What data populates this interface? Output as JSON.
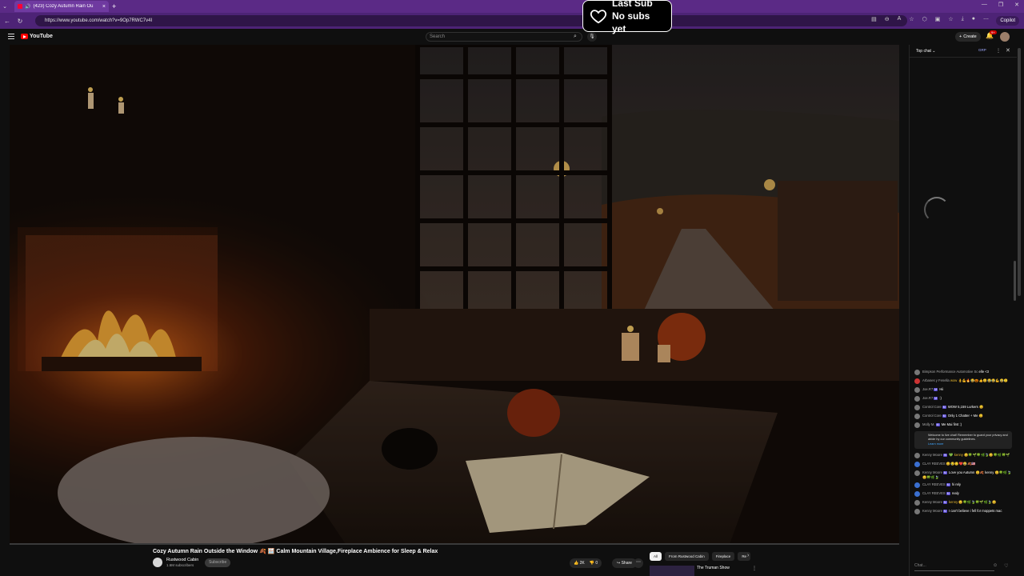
{
  "browser": {
    "tab_title": "(423) Cozy Autumn Rain Ou",
    "tab_close": "×",
    "new_tab": "+",
    "url": "https://www.youtube.com/watch?v=9Op7RWC7v4I",
    "copilot_label": "Copilot"
  },
  "overlay": {
    "line1": "Last Sub",
    "line2": "No subs yet"
  },
  "youtube": {
    "logo_text": "YouTube",
    "search_placeholder": "Search",
    "create_label": "Create",
    "notifications_count": "9+"
  },
  "video": {
    "progress_fraction": 0.0,
    "title": "Cozy Autumn Rain Outside the Window 🍂 🪟 Calm Mountain Village,Fireplace Ambience for Sleep & Relax",
    "channel_name": "Rustwood Cabin",
    "channel_subs": "1.6M subscribers",
    "subscribe_label": "Subscribe",
    "like_count": "2K",
    "dislike_count": "0",
    "share_label": "Share",
    "chips": [
      "All",
      "From Rustwood Cabin",
      "Fireplace",
      "Re"
    ],
    "rec_title": "The Truman Show"
  },
  "chat": {
    "mode": "Top chat",
    "group_label": "GRP",
    "input_placeholder": "Chat...",
    "messages": [
      {
        "name": "Bimpson Performance Automotive Sc",
        "badge": "",
        "text": "elle <3"
      },
      {
        "name": "Arbanes y Fenella",
        "badge": "",
        "text": "wow 👌💪🔥😂🎃👍😊😂😂💪😂🙂"
      },
      {
        "name": "Joe.R7",
        "badge": "M",
        "text": "Hii"
      },
      {
        "name": "Joe.R7",
        "badge": "M",
        "text": ":)"
      },
      {
        "name": "Control Core",
        "badge": "M",
        "text": "WOW 5,159 Lurkers 😊"
      },
      {
        "name": "Control Core",
        "badge": "M",
        "text": "Only 1 Chatter + Me 😊"
      },
      {
        "name": "Molly M.",
        "badge": "M",
        "text": "Me Mai first :)"
      }
    ],
    "notice_text": "Welcome to live chat! Remember to guard your privacy and abide by our community guidelines.",
    "notice_link": "Learn more",
    "messages2": [
      {
        "name": "Kenny Moore",
        "badge": "Hi",
        "text": "💚 kenny 😊🍀🌱🍀🌿🍃😊🍀🌿🍀🌱"
      },
      {
        "name": "CLAY REEVES",
        "badge": "",
        "text": "😊😢🙂❤️😂🍂🇺🇸"
      },
      {
        "name": "Kenny Moore",
        "badge": "M",
        "text": "Love you Autumn 😊🍂 kenny 😊🍀🌿🍃😊🍀🌿🍃"
      },
      {
        "name": "CLAY REEVES",
        "badge": "M",
        "text": "hi rely"
      },
      {
        "name": "CLAY REEVES",
        "badge": "M",
        "text": "realy"
      },
      {
        "name": "Kenny Moore",
        "badge": "M",
        "text": "kenny 😊🍀🌿🍃🍀🌱🌿🍃😊"
      },
      {
        "name": "Kenny Moore",
        "badge": "M",
        "text": "I can't believe i fell for moppets mac"
      }
    ]
  }
}
